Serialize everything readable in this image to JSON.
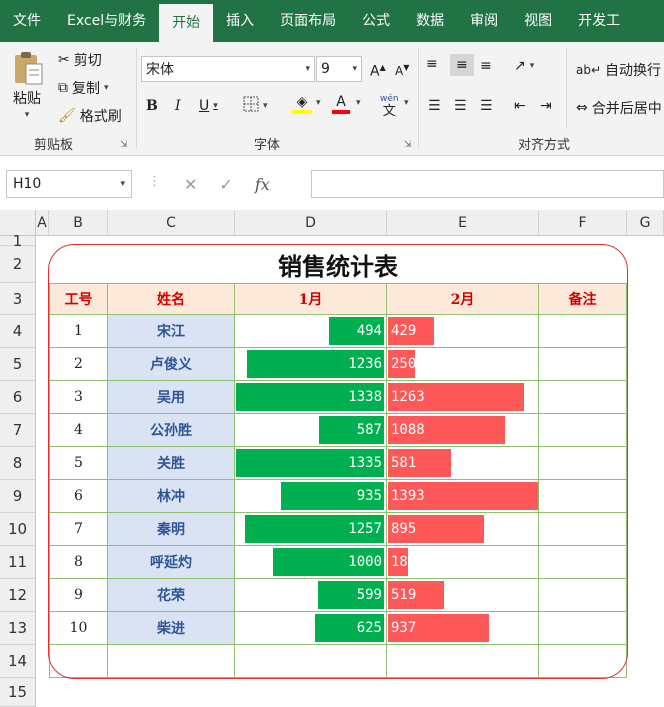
{
  "tabs": [
    "文件",
    "Excel与财务",
    "开始",
    "插入",
    "页面布局",
    "公式",
    "数据",
    "审阅",
    "视图",
    "开发工"
  ],
  "active_tab": "开始",
  "ribbon": {
    "clipboard": {
      "paste": "粘贴",
      "cut": "剪切",
      "copy": "复制",
      "format_painter": "格式刷",
      "label": "剪贴板"
    },
    "font": {
      "name": "宋体",
      "size": "9",
      "label": "字体",
      "bold": "B",
      "italic": "I",
      "underline": "U",
      "phonetic": "wén"
    },
    "align": {
      "wrap": "自动换行",
      "merge": "合并后居中",
      "label": "对齐方式"
    }
  },
  "formula_bar": {
    "name_box": "H10",
    "fx": "fx",
    "formula": ""
  },
  "columns": [
    "A",
    "B",
    "C",
    "D",
    "E",
    "F",
    "G"
  ],
  "rows": [
    "1",
    "2",
    "3",
    "4",
    "5",
    "6",
    "7",
    "8",
    "9",
    "10",
    "11",
    "12",
    "13",
    "14",
    "15"
  ],
  "table": {
    "title": "销售统计表",
    "headers": [
      "工号",
      "姓名",
      "1月",
      "2月",
      "备注"
    ],
    "records": [
      {
        "id": "1",
        "name": "宋江",
        "jan": 494,
        "feb": 429
      },
      {
        "id": "2",
        "name": "卢俊义",
        "jan": 1236,
        "feb": 250
      },
      {
        "id": "3",
        "name": "吴用",
        "jan": 1338,
        "feb": 1263
      },
      {
        "id": "4",
        "name": "公孙胜",
        "jan": 587,
        "feb": 1088
      },
      {
        "id": "5",
        "name": "关胜",
        "jan": 1335,
        "feb": 581
      },
      {
        "id": "6",
        "name": "林冲",
        "jan": 935,
        "feb": 1393
      },
      {
        "id": "7",
        "name": "秦明",
        "jan": 1257,
        "feb": 895
      },
      {
        "id": "8",
        "name": "呼延灼",
        "jan": 1000,
        "feb": 18
      },
      {
        "id": "9",
        "name": "花荣",
        "jan": 599,
        "feb": 519
      },
      {
        "id": "10",
        "name": "柴进",
        "jan": 625,
        "feb": 937
      }
    ]
  },
  "colors": {
    "accent": "#217346",
    "bar_jan": "#00b050",
    "bar_feb": "#ff5858",
    "header_fill": "#fde9d9",
    "name_fill": "#dae3f3",
    "frame": "#e03030"
  }
}
